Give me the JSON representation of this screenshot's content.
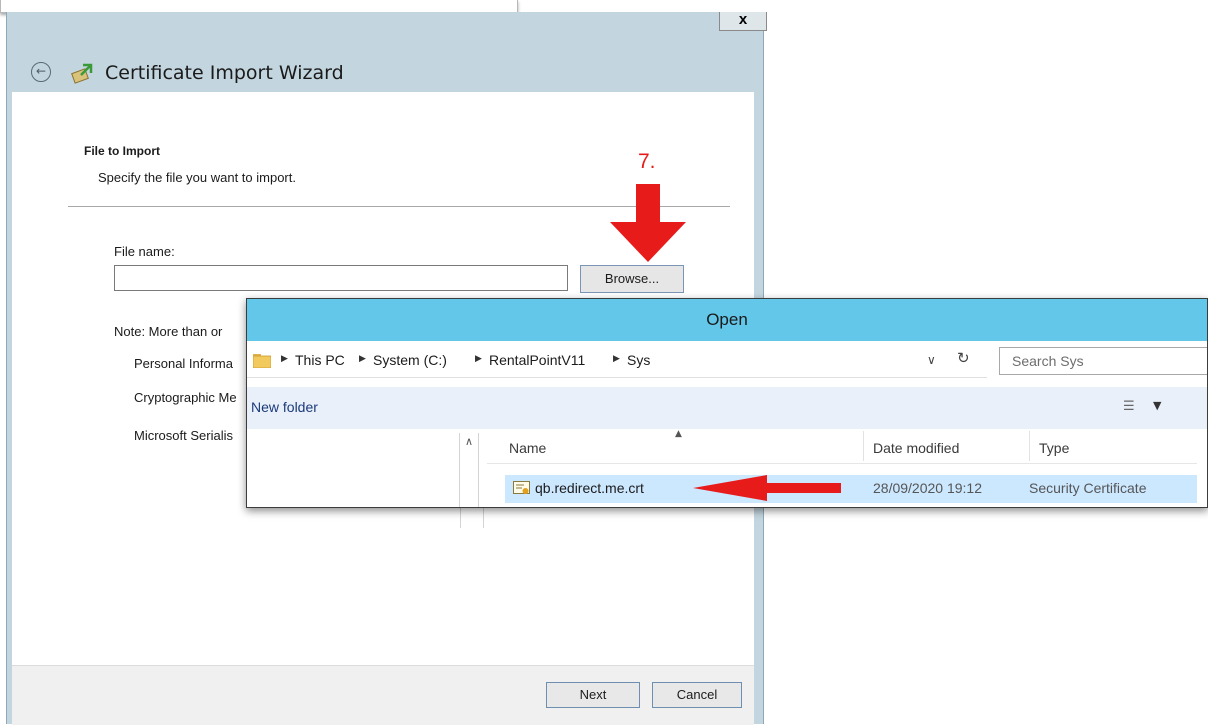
{
  "wizard": {
    "close_label": "x",
    "title": "Certificate Import Wizard",
    "section_heading": "File to Import",
    "section_description": "Specify the file you want to import.",
    "file_name_label": "File name:",
    "file_name_value": "",
    "browse_label": "Browse...",
    "note_text": "Note:  More than or",
    "formats": [
      "Personal Informa",
      "Cryptographic Me",
      "Microsoft Serialis"
    ],
    "next_label": "Next",
    "cancel_label": "Cancel"
  },
  "annotation": {
    "step_label": "7.",
    "color": "#e81b1b"
  },
  "open_dialog": {
    "title": "Open",
    "breadcrumb": [
      "This PC",
      "System (C:)",
      "RentalPointV11",
      "Sys"
    ],
    "search_placeholder": "Search Sys",
    "new_folder_label": "New folder",
    "columns": [
      "Name",
      "Date modified",
      "Type"
    ],
    "files": [
      {
        "name": "qb.redirect.me.crt",
        "date_modified": "28/09/2020 19:12",
        "type": "Security Certificate",
        "selected": true,
        "icon": "certificate-icon"
      }
    ],
    "titlebar_color": "#62c7e8",
    "selection_color": "#cce8ff"
  }
}
